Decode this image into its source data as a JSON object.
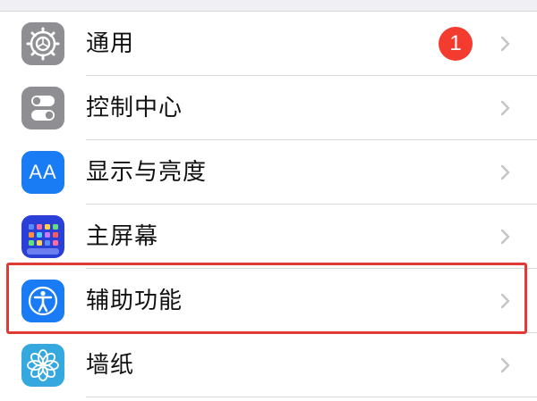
{
  "settings": {
    "items": [
      {
        "label": "通用",
        "icon": "gear-icon",
        "color": "#8e8e93",
        "badge": "1"
      },
      {
        "label": "控制中心",
        "icon": "toggles-icon",
        "color": "#8e8e93"
      },
      {
        "label": "显示与亮度",
        "icon": "text-size-icon",
        "icon_text": "AA",
        "color": "#1a7cf4"
      },
      {
        "label": "主屏幕",
        "icon": "app-grid-icon",
        "color": "#2a3fd6"
      },
      {
        "label": "辅助功能",
        "icon": "accessibility-icon",
        "color": "#1a7cf4",
        "highlighted": true
      },
      {
        "label": "墙纸",
        "icon": "flower-icon",
        "color": "#36a8e0"
      }
    ]
  },
  "colors": {
    "highlight": "#e03a35",
    "badge": "#f43b30",
    "chevron": "#c4c4c7"
  }
}
